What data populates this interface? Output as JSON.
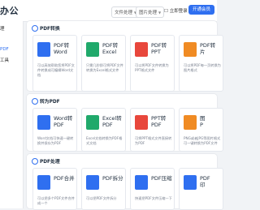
{
  "app": {
    "title": "PDF转换"
  },
  "topbar": {
    "brand": "办公",
    "menus": [
      {
        "label": "文件处理"
      },
      {
        "label": "图片处理"
      }
    ],
    "login_label": "立即登录",
    "cta_label": "开通会员"
  },
  "sidebar": {
    "items": [
      {
        "label": "理"
      },
      {
        "label": "PDF"
      },
      {
        "label": "工具"
      }
    ]
  },
  "sections": [
    {
      "title": "PDF转换",
      "cards": [
        {
          "title": "PDF转\nWord",
          "desc": "可以高效帮助您将PDF文件转换成可编辑Word文档",
          "color": "#2f6ff0"
        },
        {
          "title": "PDF转\nExcel",
          "desc": "只需几秒即可将PDF文件转换为Excel格式文件",
          "color": "#20a96b"
        },
        {
          "title": "PDF转\nPPT",
          "desc": "可以将PDF文件转换为PPT格式文件",
          "color": "#e8473c"
        },
        {
          "title": "PDF转\n片",
          "desc": "可以将PDF每一页转换为图片格式",
          "color": "#f08b23"
        }
      ]
    },
    {
      "title": "转为PDF",
      "cards": [
        {
          "title": "Word转\nPDF",
          "desc": "Word文档可快速一键转换并保存为PDF",
          "color": "#2f6ff0"
        },
        {
          "title": "Excel转\nPDF",
          "desc": "Excel文档转换为PDF格式文档",
          "color": "#20a96b"
        },
        {
          "title": "PPT转\nPDF",
          "desc": "可将PPT格式文件直接转为PDF",
          "color": "#e8473c"
        },
        {
          "title": "图\nP",
          "desc": "PNG或者JPG等图片格式可一键转换为PDF文件",
          "color": "#f08b23"
        }
      ]
    },
    {
      "title": "PDF处理",
      "cards": [
        {
          "title": "PDF合并",
          "desc": "可以把多个PDF文件合并成一个",
          "color": "#2f6ff0"
        },
        {
          "title": "PDF拆分",
          "desc": "可以把PDF文件拆分",
          "color": "#2f6ff0"
        },
        {
          "title": "PDF压缩",
          "desc": "快速把PDF文件压缩一下",
          "color": "#2f6ff0"
        },
        {
          "title": "PDF\n印",
          "desc": "",
          "color": "#2f6ff0"
        }
      ]
    }
  ]
}
